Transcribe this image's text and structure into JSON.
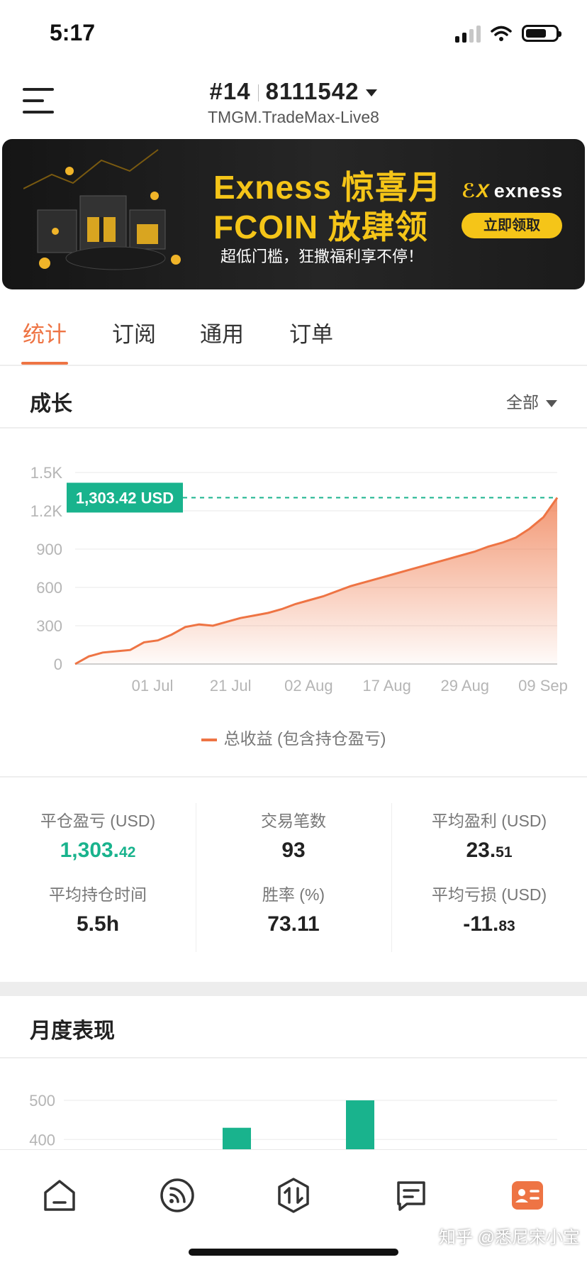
{
  "status": {
    "time": "5:17"
  },
  "header": {
    "account_number": "#14",
    "account_id": "8111542",
    "server": "TMGM.TradeMax-Live8"
  },
  "banner": {
    "line1": "Exness 惊喜月",
    "line2": "FCOIN 放肆领",
    "subtitle": "超低门槛，狂撒福利享不停！",
    "brand": "exness",
    "cta": "立即领取"
  },
  "tabs": [
    "统计",
    "订阅",
    "通用",
    "订单"
  ],
  "growth": {
    "title": "成长",
    "range": "全部",
    "current_value_label": "1,303.42 USD",
    "legend": "总收益 (包含持仓盈亏)"
  },
  "chart_data": [
    {
      "type": "area",
      "ylim": [
        0,
        1500
      ],
      "y_ticks": [
        "0",
        "300",
        "600",
        "900",
        "1.2K",
        "1.5K"
      ],
      "x_tick_labels": [
        "01 Jul",
        "21 Jul",
        "02 Aug",
        "17 Aug",
        "29 Aug",
        "09 Sep"
      ],
      "series": [
        {
          "name": "总收益 (包含持仓盈亏)",
          "color": "#ee7444",
          "x": [
            0,
            1,
            2,
            3,
            4,
            5,
            6,
            7,
            8,
            9,
            10,
            11,
            12,
            13,
            14,
            15,
            16,
            17,
            18,
            19,
            20,
            21,
            22,
            23,
            24,
            25,
            26,
            27,
            28,
            29,
            30,
            31,
            32,
            33,
            34,
            35
          ],
          "values": [
            0,
            60,
            90,
            100,
            110,
            170,
            185,
            230,
            290,
            310,
            300,
            330,
            360,
            380,
            400,
            430,
            470,
            500,
            530,
            570,
            610,
            640,
            670,
            700,
            730,
            760,
            790,
            820,
            850,
            880,
            920,
            950,
            990,
            1060,
            1150,
            1303
          ]
        }
      ],
      "annotation": "1,303.42 USD"
    },
    {
      "type": "bar",
      "ylim": [
        300,
        520
      ],
      "y_ticks": [
        "400",
        "500"
      ],
      "categories": [
        "",
        "",
        "",
        "",
        ""
      ],
      "values": [
        null,
        null,
        430,
        null,
        500
      ],
      "color": "#19b38d"
    }
  ],
  "stats": [
    {
      "label": "平仓盈亏 (USD)",
      "int": "1,303.",
      "dec": "42",
      "color": "green"
    },
    {
      "label": "交易笔数",
      "int": "93",
      "dec": ""
    },
    {
      "label": "平均盈利 (USD)",
      "int": "23.",
      "dec": "51"
    },
    {
      "label": "平均持仓时间",
      "int": "5.5h",
      "dec": ""
    },
    {
      "label": "胜率 (%)",
      "int": "73.11",
      "dec": ""
    },
    {
      "label": "平均亏损 (USD)",
      "int": "-11.",
      "dec": "83"
    }
  ],
  "monthly": {
    "title": "月度表现"
  },
  "bottom_nav": [
    {
      "name": "home",
      "icon": "home-icon"
    },
    {
      "name": "feed",
      "icon": "signal-icon"
    },
    {
      "name": "trade",
      "icon": "trade-icon"
    },
    {
      "name": "messages",
      "icon": "chat-icon"
    },
    {
      "name": "profile",
      "icon": "profile-card-icon"
    }
  ],
  "colors": {
    "accent": "#ee7444",
    "green": "#19b38d",
    "banner_gold": "#f5c518"
  },
  "watermark": "知乎 @悉尼宋小宝"
}
